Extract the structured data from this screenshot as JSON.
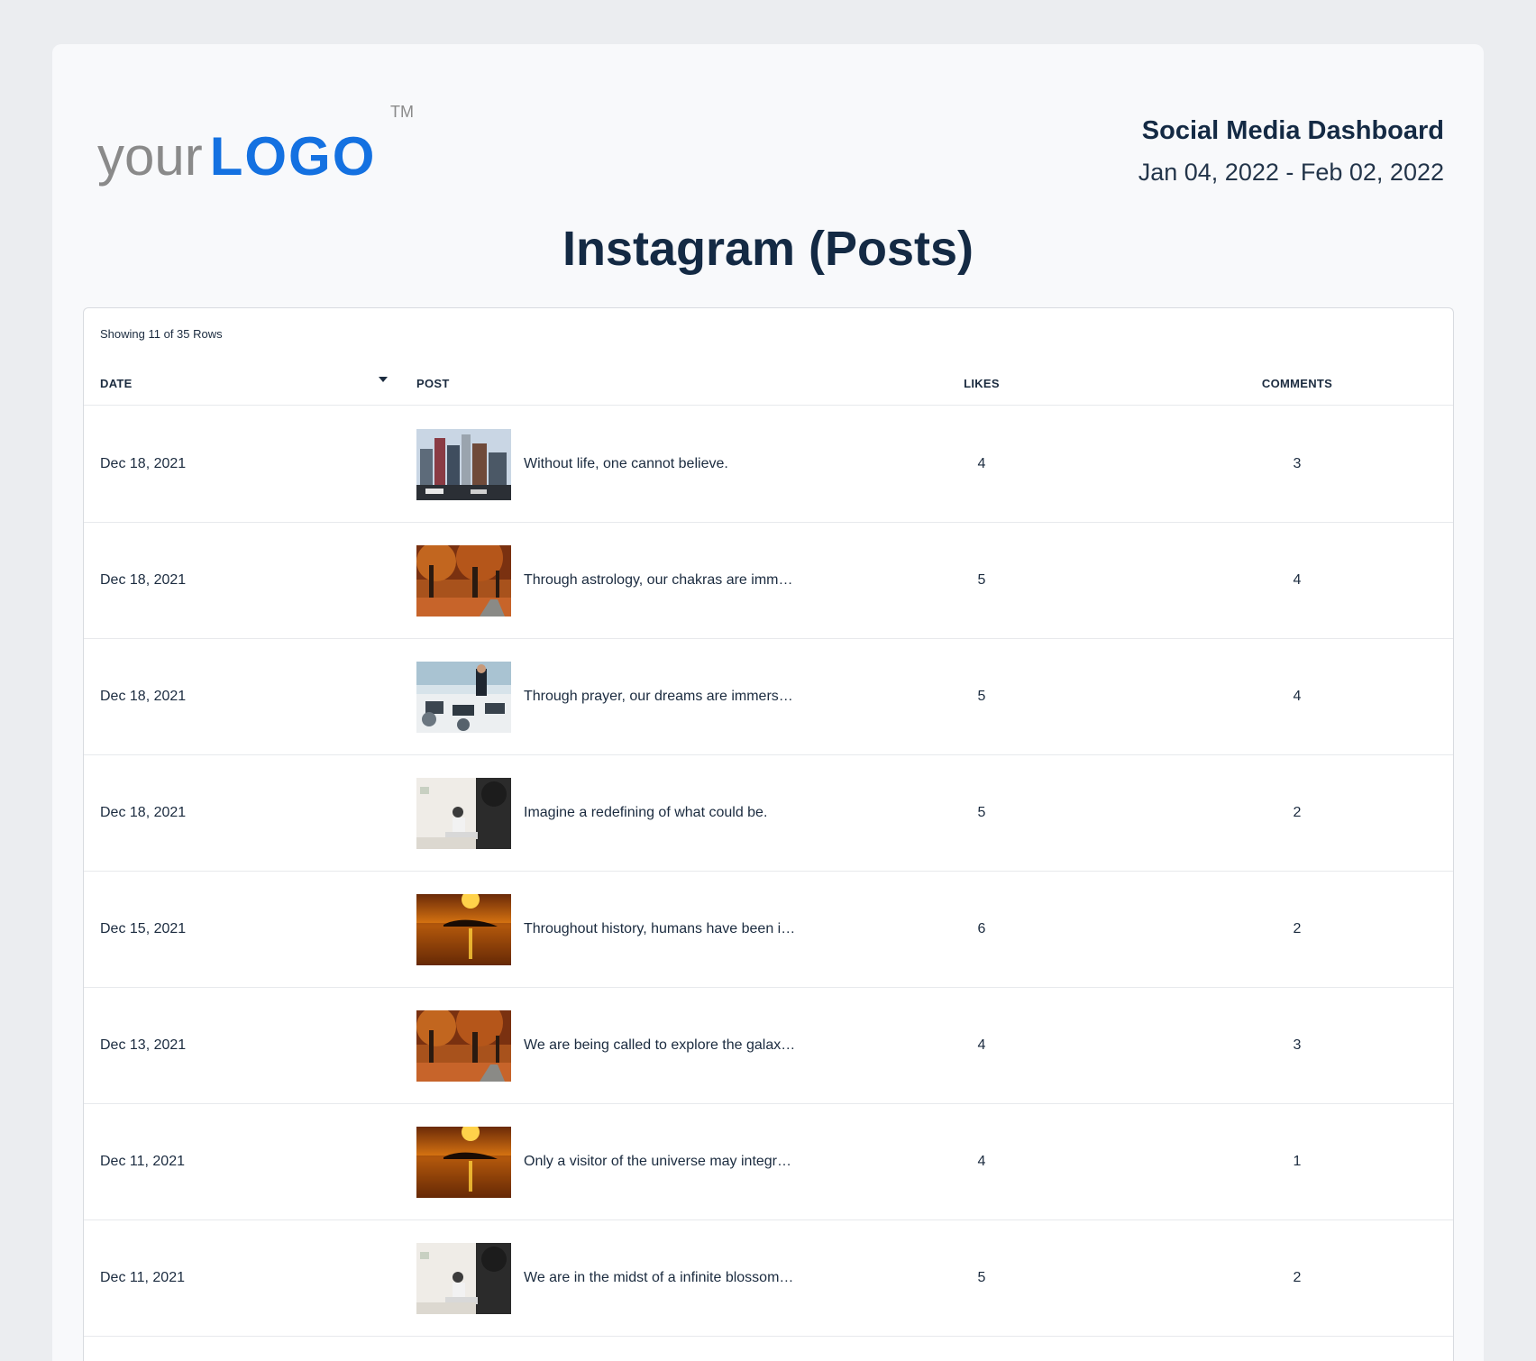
{
  "logo": {
    "your": "your",
    "main": "LOGO",
    "tm": "TM"
  },
  "header": {
    "title": "Social Media Dashboard",
    "date_range": "Jan 04, 2022 - Feb 02, 2022"
  },
  "page_title": "Instagram (Posts)",
  "table": {
    "rows_info": "Showing 11 of 35 Rows",
    "columns": {
      "date": "DATE",
      "post": "POST",
      "likes": "LIKES",
      "comments": "COMMENTS"
    },
    "rows": [
      {
        "date": "Dec 18, 2021",
        "thumb": "city-image",
        "post": "Without life, one cannot believe.",
        "likes": "4",
        "comments": "3"
      },
      {
        "date": "Dec 18, 2021",
        "thumb": "autumn-image",
        "post": "Through astrology, our chakras are imm…",
        "likes": "5",
        "comments": "4"
      },
      {
        "date": "Dec 18, 2021",
        "thumb": "office-image",
        "post": "Through prayer, our dreams are immers…",
        "likes": "5",
        "comments": "4"
      },
      {
        "date": "Dec 18, 2021",
        "thumb": "meeting-image",
        "post": "Imagine a redefining of what could be.",
        "likes": "5",
        "comments": "2"
      },
      {
        "date": "Dec 15, 2021",
        "thumb": "sunset-image",
        "post": "Throughout history, humans have been i…",
        "likes": "6",
        "comments": "2"
      },
      {
        "date": "Dec 13, 2021",
        "thumb": "autumn-image",
        "post": "We are being called to explore the galax…",
        "likes": "4",
        "comments": "3"
      },
      {
        "date": "Dec 11, 2021",
        "thumb": "sunset-image",
        "post": "Only a visitor of the universe may integr…",
        "likes": "4",
        "comments": "1"
      },
      {
        "date": "Dec 11, 2021",
        "thumb": "meeting-image",
        "post": "We are in the midst of a infinite blossom…",
        "likes": "5",
        "comments": "2"
      }
    ]
  },
  "icons": {
    "sort": "sort-desc-caret-icon"
  }
}
